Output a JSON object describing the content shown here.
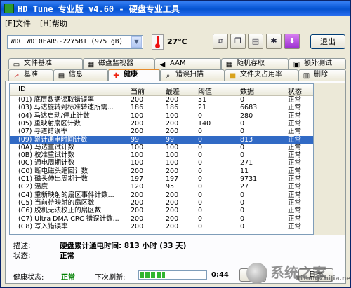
{
  "window": {
    "title": "HD Tune 专业版 v4.60 - 硬盘专业工具"
  },
  "menu": {
    "file": "[F]文件",
    "help": "[H]帮助"
  },
  "toolbar": {
    "drive": "WDC WD10EARS-22Y5B1        (975 gB)",
    "temperature": "27℃",
    "exit_label": "退出"
  },
  "tabs_top": [
    {
      "label": "文件基准",
      "icon": "file-icon"
    },
    {
      "label": "磁盘监视器",
      "icon": "monitor-icon"
    },
    {
      "label": "AAM",
      "icon": "speaker-icon"
    },
    {
      "label": "随机存取",
      "icon": "random-access-icon"
    },
    {
      "label": "额外测试",
      "icon": "extra-tests-icon"
    }
  ],
  "tabs_bottom": [
    {
      "label": "基准",
      "icon": "benchmark-icon"
    },
    {
      "label": "信息",
      "icon": "info-icon"
    },
    {
      "label": "健康",
      "icon": "health-cross-icon",
      "active": true
    },
    {
      "label": "错误扫描",
      "icon": "magnifier-icon"
    },
    {
      "label": "文件夹占用率",
      "icon": "folder-icon"
    },
    {
      "label": "删除",
      "icon": "trash-icon"
    }
  ],
  "table": {
    "columns": [
      "ID",
      "当前",
      "最差",
      "阈值",
      "数据",
      "状态"
    ],
    "rows": [
      {
        "id": "(01) 底层数据读取错误率",
        "cur": "200",
        "worst": "200",
        "thr": "51",
        "data": "0",
        "status": "正常"
      },
      {
        "id": "(03) 马达旋转到标准转速所需...",
        "cur": "186",
        "worst": "186",
        "thr": "21",
        "data": "6683",
        "status": "正常"
      },
      {
        "id": "(04) 马达启动/停止计数",
        "cur": "100",
        "worst": "100",
        "thr": "0",
        "data": "280",
        "status": "正常"
      },
      {
        "id": "(05) 重映射扇区计数",
        "cur": "200",
        "worst": "200",
        "thr": "140",
        "data": "0",
        "status": "正常"
      },
      {
        "id": "(07) 寻道错误率",
        "cur": "200",
        "worst": "200",
        "thr": "0",
        "data": "0",
        "status": "正常"
      },
      {
        "id": "(09) 累计通电时间计数",
        "cur": "99",
        "worst": "99",
        "thr": "0",
        "data": "813",
        "status": "正常",
        "selected": true
      },
      {
        "id": "(0A) 马达重试计数",
        "cur": "100",
        "worst": "100",
        "thr": "0",
        "data": "0",
        "status": "正常"
      },
      {
        "id": "(0B) 校准重试计数",
        "cur": "100",
        "worst": "100",
        "thr": "0",
        "data": "0",
        "status": "正常"
      },
      {
        "id": "(0C) 通电周期计数",
        "cur": "100",
        "worst": "100",
        "thr": "0",
        "data": "271",
        "status": "正常"
      },
      {
        "id": "(C0) 断电磁头缩回计数",
        "cur": "200",
        "worst": "200",
        "thr": "0",
        "data": "11",
        "status": "正常"
      },
      {
        "id": "(C1) 磁头伸出周期计数",
        "cur": "197",
        "worst": "197",
        "thr": "0",
        "data": "9731",
        "status": "正常"
      },
      {
        "id": "(C2) 温度",
        "cur": "120",
        "worst": "95",
        "thr": "0",
        "data": "27",
        "status": "正常"
      },
      {
        "id": "(C4) 重新映射的扇区事件计数...",
        "cur": "200",
        "worst": "200",
        "thr": "0",
        "data": "0",
        "status": "正常"
      },
      {
        "id": "(C5) 当前待映射的扇区数",
        "cur": "200",
        "worst": "200",
        "thr": "0",
        "data": "0",
        "status": "正常"
      },
      {
        "id": "(C6) 脱机无法校正的扇区数",
        "cur": "200",
        "worst": "200",
        "thr": "0",
        "data": "0",
        "status": "正常"
      },
      {
        "id": "(C7) Ultra DMA CRC 错误计数...",
        "cur": "200",
        "worst": "200",
        "thr": "0",
        "data": "0",
        "status": "正常"
      },
      {
        "id": "(C8) 写入错误率",
        "cur": "200",
        "worst": "200",
        "thr": "0",
        "data": "0",
        "status": "正常"
      }
    ]
  },
  "details": {
    "desc_label": "描述:",
    "desc_value": "硬盘累计通电时间: 813 小时 (33 天)",
    "state_label": "状态:",
    "state_value": "正常"
  },
  "statusbar": {
    "health_label": "健康状态:",
    "health_value": "正常",
    "refresh_label": "下次刷新:",
    "refresh_progress": 0.38,
    "time": "0:44",
    "log_label": "日志"
  },
  "watermark": {
    "main": "系统之家",
    "sub": "XiTongZhiJia.net"
  },
  "colors": {
    "selection": "#316ac5",
    "status_green": "#008000",
    "title_blue": "#0753d0"
  }
}
